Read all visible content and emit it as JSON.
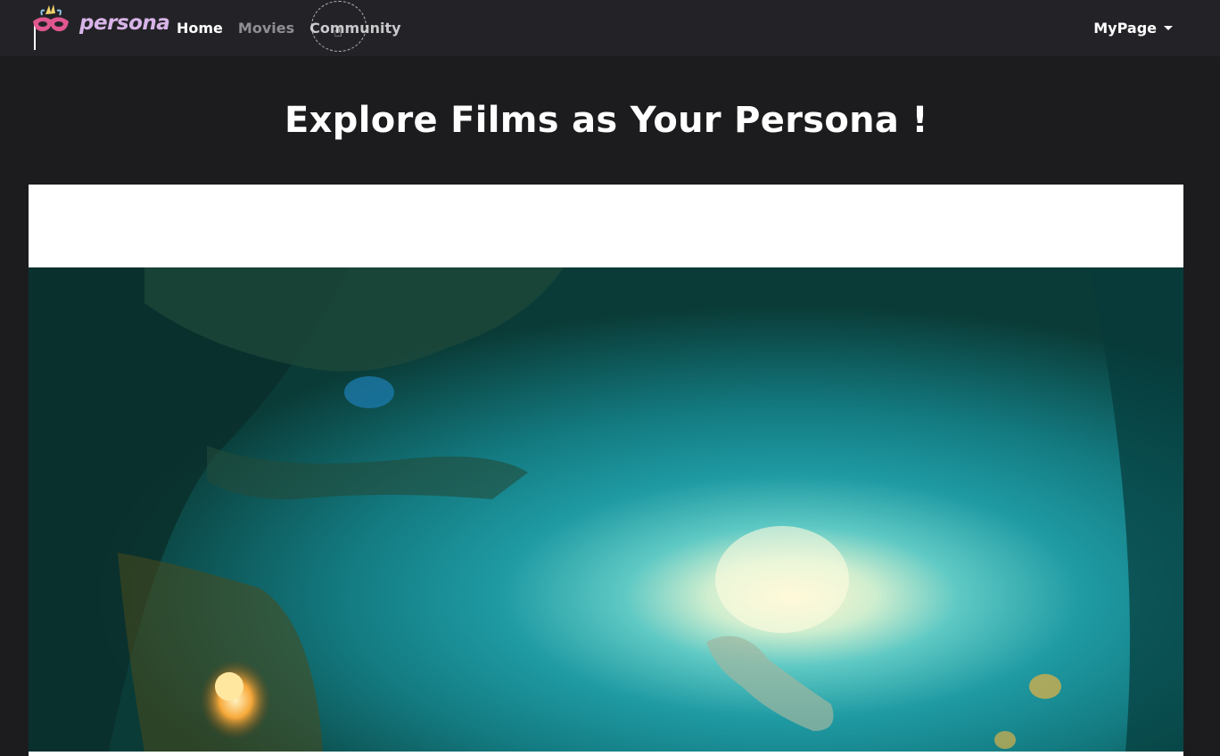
{
  "navbar": {
    "brand": {
      "name": "persona",
      "logo_icon": "masquerade-mask-icon"
    },
    "links": [
      {
        "label": "Home",
        "state": "active"
      },
      {
        "label": "Movies",
        "state": "inactive"
      },
      {
        "label": "Community",
        "state": "hover"
      }
    ],
    "user_menu": {
      "label": "MyPage",
      "icon": "caret-down-icon"
    }
  },
  "hero": {
    "title": "Explore Films as Your Persona !"
  },
  "carousel": {
    "slide_image": "underwater-cave-light-scene",
    "colors": {
      "deep": "#0a3b37",
      "mid": "#137a80",
      "glow": "#fff6cf",
      "lamp": "#f0a030"
    }
  },
  "colors": {
    "navbar_bg": "#232327",
    "page_bg": "#1c1c1e",
    "brand": "#d8b4e8",
    "link_active": "#ffffff",
    "link_inactive": "#8e8e93"
  }
}
